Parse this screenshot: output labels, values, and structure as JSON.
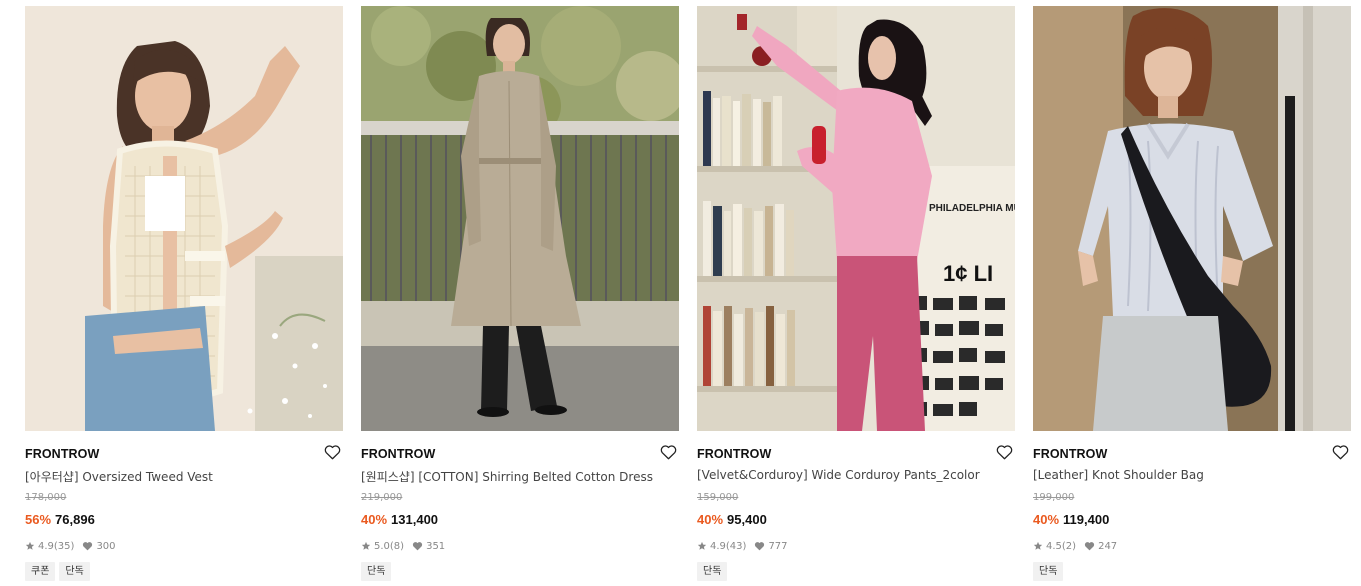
{
  "products": [
    {
      "brand": "FRONTROW",
      "name": "[아우터샵] Oversized Tweed Vest",
      "original_price": "178,000",
      "discount": "56%",
      "price": "76,896",
      "rating": "4.9",
      "review_count": "(35)",
      "likes": "300",
      "tags": [
        "쿠폰",
        "단독"
      ]
    },
    {
      "brand": "FRONTROW",
      "name": "[원피스샵] [COTTON] Shirring Belted Cotton Dress",
      "original_price": "219,000",
      "discount": "40%",
      "price": "131,400",
      "rating": "5.0",
      "review_count": "(8)",
      "likes": "351",
      "tags": [
        "단독"
      ]
    },
    {
      "brand": "FRONTROW",
      "name": "[Velvet&Corduroy] Wide Corduroy Pants_2color",
      "original_price": "159,000",
      "discount": "40%",
      "price": "95,400",
      "rating": "4.9",
      "review_count": "(43)",
      "likes": "777",
      "tags": [
        "단독"
      ]
    },
    {
      "brand": "FRONTROW",
      "name": "[Leather] Knot Shoulder Bag",
      "original_price": "199,000",
      "discount": "40%",
      "price": "119,400",
      "rating": "4.5",
      "review_count": "(2)",
      "likes": "247",
      "tags": [
        "단독"
      ]
    }
  ],
  "icons": {
    "wishlist": "heart-outline-icon",
    "rating": "star-icon",
    "likes": "heart-filled-icon"
  },
  "colors": {
    "discount": "#ea5a20",
    "tag_bg": "#f1f1f1"
  }
}
